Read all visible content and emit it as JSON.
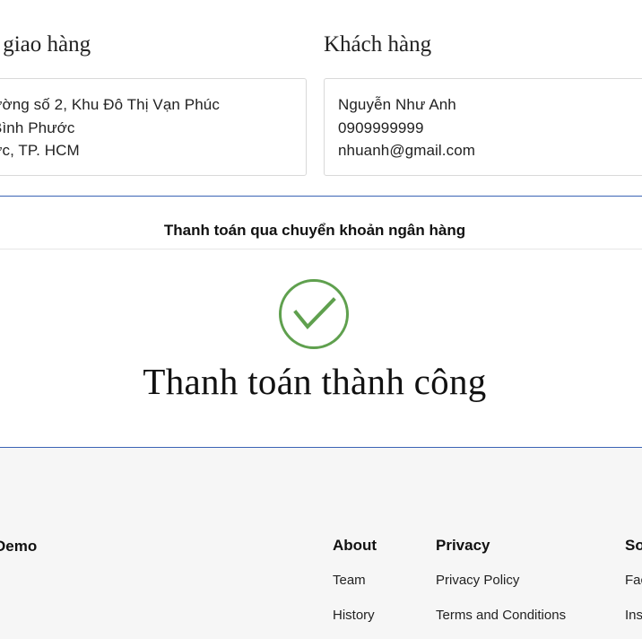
{
  "shipping": {
    "heading": "i giao hàng",
    "address_lines": [
      "ường số 2, Khu Đô Thị Vạn Phúc",
      "Bình Phước",
      "ức, TP. HCM"
    ]
  },
  "customer": {
    "heading": "Khách hàng",
    "name": "Nguyễn Như Anh",
    "phone": "0909999999",
    "email": "nhuanh@gmail.com"
  },
  "payment": {
    "method": "Thanh toán qua chuyển khoản ngân hàng",
    "status_icon": "check-circle-icon",
    "status_text": "Thanh toán thành công",
    "success_color": "#5fa04e"
  },
  "footer": {
    "brand": "Demo",
    "columns": [
      {
        "title": "About",
        "links": [
          "Team",
          "History"
        ]
      },
      {
        "title": "Privacy",
        "links": [
          "Privacy Policy",
          "Terms and Conditions"
        ]
      },
      {
        "title": "So",
        "links": [
          "Fac",
          "Ins"
        ]
      }
    ]
  }
}
